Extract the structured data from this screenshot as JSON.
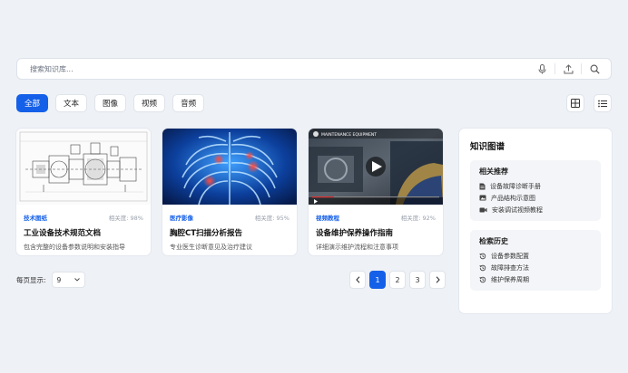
{
  "search": {
    "placeholder": "搜索知识库..."
  },
  "filters": {
    "tabs": [
      {
        "label": "全部",
        "active": true
      },
      {
        "label": "文本",
        "active": false
      },
      {
        "label": "图像",
        "active": false
      },
      {
        "label": "视频",
        "active": false
      },
      {
        "label": "音频",
        "active": false
      }
    ]
  },
  "cards": [
    {
      "category": "技术图纸",
      "relevance": "相关度: 98%",
      "title": "工业设备技术规范文档",
      "desc": "包含完整的设备参数说明和安装指导"
    },
    {
      "category": "医疗影像",
      "relevance": "相关度: 95%",
      "title": "胸腔CT扫描分析报告",
      "desc": "专业医生诊断意见及治疗建议"
    },
    {
      "category": "视频教程",
      "relevance": "相关度: 92%",
      "title": "设备维护保养操作指南",
      "desc": "详细演示维护流程和注意事项",
      "video_caption": "MAINTENANCE EQUIPMENT"
    }
  ],
  "pagination": {
    "per_page_label": "每页显示:",
    "per_page_value": "9",
    "pages": [
      "1",
      "2",
      "3"
    ],
    "current": "1"
  },
  "knowledge_panel": {
    "title": "知识图谱",
    "related_title": "相关推荐",
    "related": [
      {
        "label": "设备故障诊断手册",
        "icon": "document-icon"
      },
      {
        "label": "产品结构示意图",
        "icon": "image-icon"
      },
      {
        "label": "安装调试视频教程",
        "icon": "video-icon"
      }
    ],
    "history_title": "检索历史",
    "history": [
      {
        "label": "设备参数配置",
        "icon": "history-icon"
      },
      {
        "label": "故障排查方法",
        "icon": "history-icon"
      },
      {
        "label": "维护保养周期",
        "icon": "history-icon"
      }
    ]
  },
  "colors": {
    "accent": "#1560e8",
    "background": "#eef1f6"
  }
}
